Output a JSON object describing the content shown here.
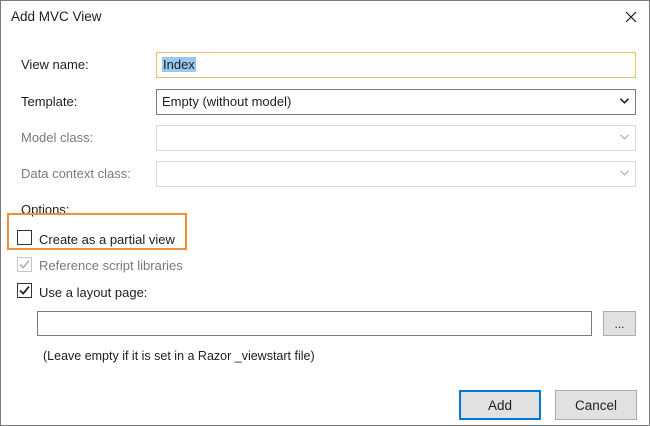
{
  "window": {
    "title": "Add MVC View"
  },
  "icons": {
    "close": "close-icon",
    "dropdown": "chevron-down-icon",
    "check": "checkmark-icon"
  },
  "colors": {
    "accent": "#0078d7",
    "highlight": "#f0913a",
    "focus": "#e6c26a",
    "selection": "#99c9ef"
  },
  "form": {
    "view_name_label": "View name:",
    "view_name_value": "Index",
    "template_label": "Template:",
    "template_value": "Empty (without model)",
    "model_class_label": "Model class:",
    "model_class_value": "",
    "data_context_label": "Data context class:",
    "data_context_value": ""
  },
  "options": {
    "label": "Options:",
    "partial_view": {
      "label": "Create as a partial view",
      "checked": false
    },
    "reference_scripts": {
      "label": "Reference script libraries",
      "checked": true,
      "enabled": false
    },
    "use_layout": {
      "label": "Use a layout page:",
      "checked": true
    },
    "layout_path_value": "",
    "browse_label": "...",
    "hint": "(Leave empty if it is set in a Razor _viewstart file)"
  },
  "buttons": {
    "add": "Add",
    "cancel": "Cancel"
  }
}
